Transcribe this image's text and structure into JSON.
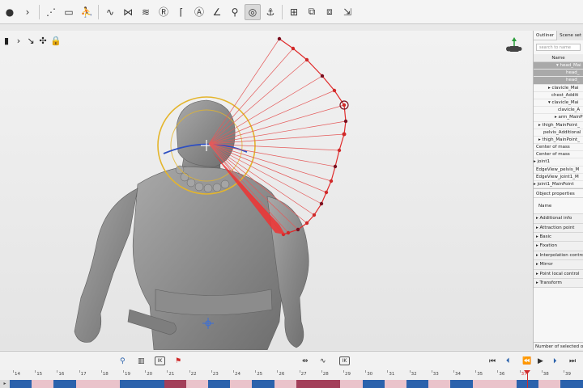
{
  "toolbar": {
    "buttons": [
      {
        "name": "record-icon",
        "glyph": "●"
      },
      {
        "name": "play-forward-icon",
        "glyph": "›"
      },
      {
        "name": "move-tool-icon",
        "glyph": "⋰"
      },
      {
        "name": "frame-icon",
        "glyph": "▭"
      },
      {
        "name": "figure-icon",
        "glyph": "⛹"
      },
      {
        "name": "curve-tool-icon",
        "glyph": "∿"
      },
      {
        "name": "graph-tool-icon",
        "glyph": "⋈"
      },
      {
        "name": "layers-icon",
        "glyph": "≋"
      },
      {
        "name": "reset-icon",
        "glyph": "Ⓡ"
      },
      {
        "name": "bracket-icon",
        "glyph": "⌈"
      },
      {
        "name": "at-target-icon",
        "glyph": "Ⓐ"
      },
      {
        "name": "angle-icon",
        "glyph": "∠"
      },
      {
        "name": "pin-icon",
        "glyph": "⚲"
      },
      {
        "name": "target-icon",
        "glyph": "◎"
      },
      {
        "name": "anchor-icon",
        "glyph": "⚓"
      },
      {
        "name": "grid-icon",
        "glyph": "⊞"
      },
      {
        "name": "copy-icon",
        "glyph": "⧉"
      },
      {
        "name": "paste-icon",
        "glyph": "⧈"
      },
      {
        "name": "snap-icon",
        "glyph": "⇲"
      }
    ]
  },
  "panel": {
    "tab_outliner": "Outliner",
    "tab_scene": "Scene set",
    "search_placeholder": "search to name",
    "column_name": "Name",
    "tree": [
      {
        "label": "▾ head_Mai",
        "indent": 28,
        "hl": true
      },
      {
        "label": "head_",
        "indent": 40,
        "hl": true
      },
      {
        "label": "head_",
        "indent": 40,
        "hl": true
      },
      {
        "label": "▸ clavicle_Mai",
        "indent": 18,
        "hl": false
      },
      {
        "label": "chest_Additi",
        "indent": 22,
        "hl": false
      },
      {
        "label": "▾ clavicle_Mai",
        "indent": 18,
        "hl": false
      },
      {
        "label": "clavicle_A",
        "indent": 30,
        "hl": false
      },
      {
        "label": "▸ arm_MainP",
        "indent": 26,
        "hl": false
      },
      {
        "label": "▸ thigh_MainPoint_",
        "indent": 6,
        "hl": false
      },
      {
        "label": "pelvis_Additional",
        "indent": 12,
        "hl": false
      },
      {
        "label": "▸ thigh_MainPoint_",
        "indent": 6,
        "hl": false
      },
      {
        "label": "Center of mass",
        "indent": 3,
        "hl": false
      },
      {
        "label": "Center of mass",
        "indent": 3,
        "hl": false
      },
      {
        "label": "▸ joint1",
        "indent": 0,
        "hl": false
      },
      {
        "label": "EdgeView_pelvis_M",
        "indent": 3,
        "hl": false
      },
      {
        "label": "EdgeView_joint1_M",
        "indent": 3,
        "hl": false
      },
      {
        "label": "▸ joint1_MainPoint",
        "indent": 0,
        "hl": false
      }
    ],
    "props_title": "Object properties",
    "props_name": "Name",
    "prop_sections": [
      "▸ Additional info",
      "▸ Attraction point",
      "▸ Basic",
      "▸ Fixation",
      "▸ Interpolation control",
      "▸ Mirror",
      "▸ Point local control",
      "▸ Transform"
    ],
    "footer": "Number of selected o"
  },
  "timeline": {
    "ruler": [
      "14",
      "15",
      "16",
      "17",
      "18",
      "19",
      "20",
      "21",
      "22",
      "23",
      "24",
      "25",
      "26",
      "27",
      "28",
      "29",
      "30",
      "31",
      "32",
      "33",
      "34",
      "35",
      "36",
      "37",
      "38",
      "39"
    ],
    "current_frame": "37",
    "track_label": "▸",
    "ik_label_1": "IK",
    "ik_label_2": "IK",
    "segments": [
      "b",
      "p",
      "b",
      "p",
      "p",
      "b",
      "b",
      "d",
      "p",
      "b",
      "p",
      "b",
      "p",
      "d",
      "d",
      "p",
      "b",
      "p",
      "b",
      "p",
      "b",
      "p",
      "p",
      "b",
      "p",
      "b"
    ]
  },
  "colors": {
    "accent_red": "#d02a2a",
    "keyframe_blue": "#2b62ac",
    "keyframe_pink": "#eac3cb",
    "keyframe_dark": "#a33f5a",
    "gizmo_gold": "#e4b52c",
    "gizmo_blue": "#2e4fc2"
  }
}
